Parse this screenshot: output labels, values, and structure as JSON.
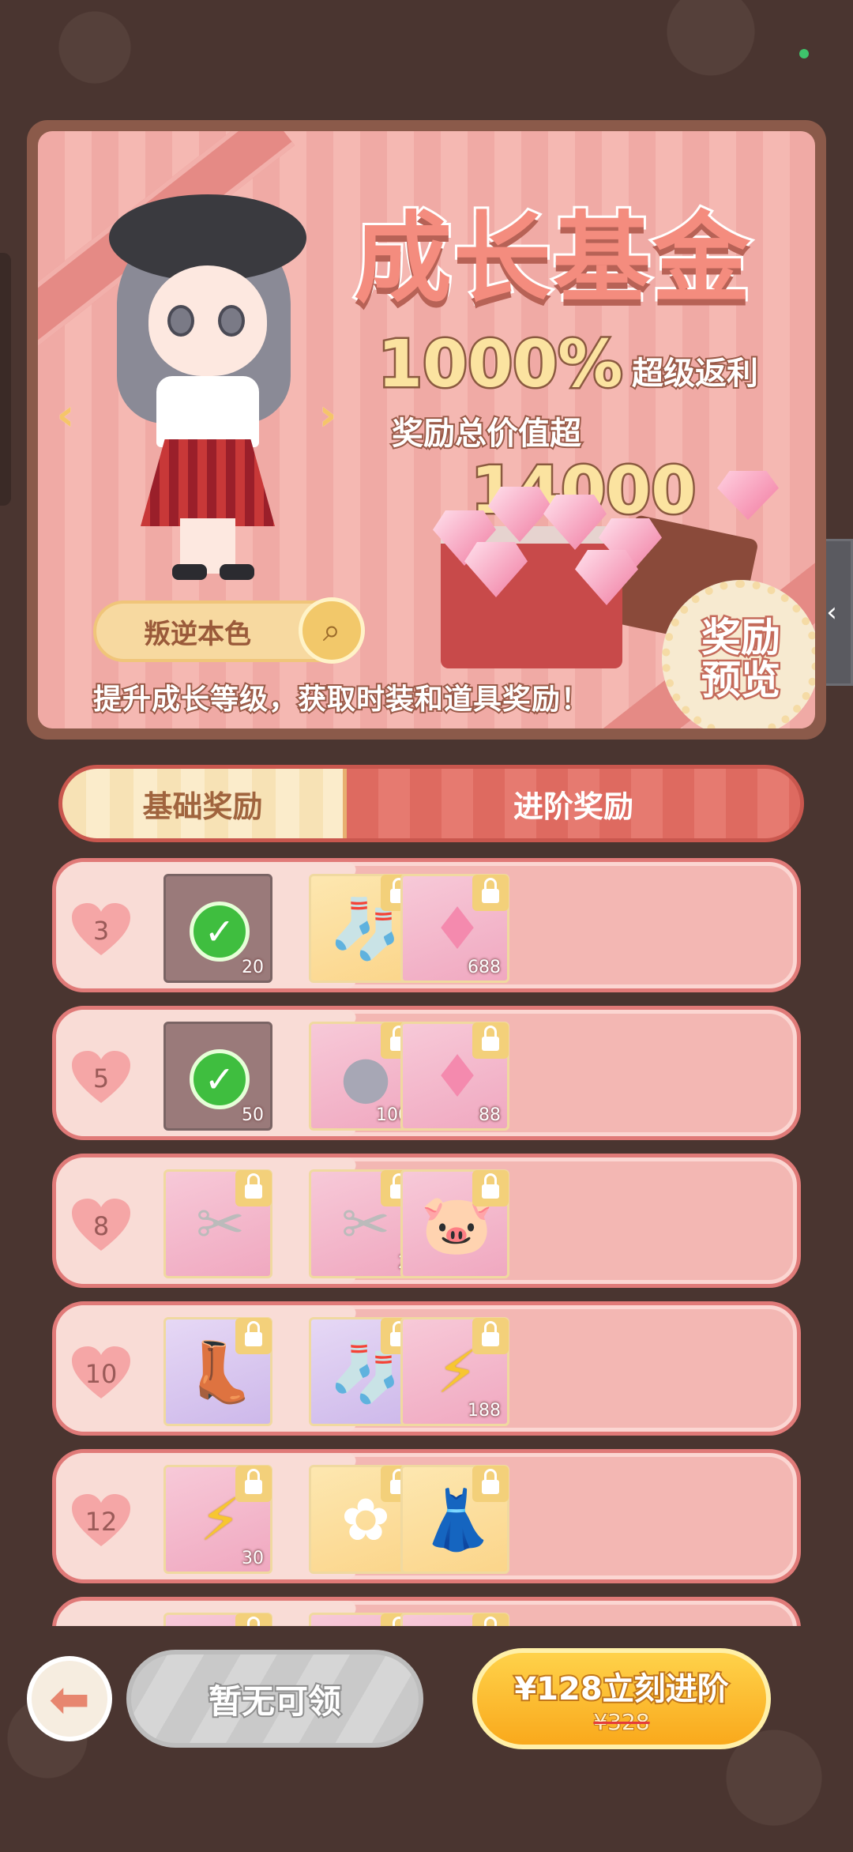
{
  "banner": {
    "title": "成长基金",
    "percent": "1000%",
    "percent_sub": "超级返利",
    "value_label": "奖励总价值超",
    "value_amount": "14000",
    "character_name": "叛逆本色",
    "caption": "提升成长等级，获取时装和道具奖励！",
    "preview_line1": "奖励",
    "preview_line2": "预览"
  },
  "tabs": {
    "basic": "基础奖励",
    "advanced": "进阶奖励"
  },
  "rows": [
    {
      "level": "3",
      "basic": {
        "icon": "energy-bolt",
        "qty": "20",
        "claimed": true
      },
      "adv": [
        {
          "icon": "white-socks",
          "qty": ""
        },
        {
          "icon": "pink-gem",
          "qty": "688"
        }
      ]
    },
    {
      "level": "5",
      "basic": {
        "icon": "paw-coin",
        "qty": "50",
        "claimed": true
      },
      "adv": [
        {
          "icon": "paw-coin",
          "qty": "100"
        },
        {
          "icon": "pink-gem",
          "qty": "88"
        }
      ]
    },
    {
      "level": "8",
      "basic": {
        "icon": "scissors",
        "qty": ""
      },
      "adv": [
        {
          "icon": "scissors",
          "qty": "2"
        },
        {
          "icon": "piggy-bank",
          "qty": ""
        }
      ]
    },
    {
      "level": "10",
      "basic": {
        "icon": "boots",
        "qty": ""
      },
      "adv": [
        {
          "icon": "bunny-socks",
          "qty": ""
        },
        {
          "icon": "energy-bolt",
          "qty": "188"
        }
      ]
    },
    {
      "level": "12",
      "basic": {
        "icon": "energy-bolt",
        "qty": "30"
      },
      "adv": [
        {
          "icon": "white-flower",
          "qty": ""
        },
        {
          "icon": "white-dress",
          "qty": ""
        }
      ]
    }
  ],
  "bottom": {
    "claim_label": "暂无可领",
    "upgrade_label": "¥128立刻进阶",
    "upgrade_old_price": "¥328"
  }
}
